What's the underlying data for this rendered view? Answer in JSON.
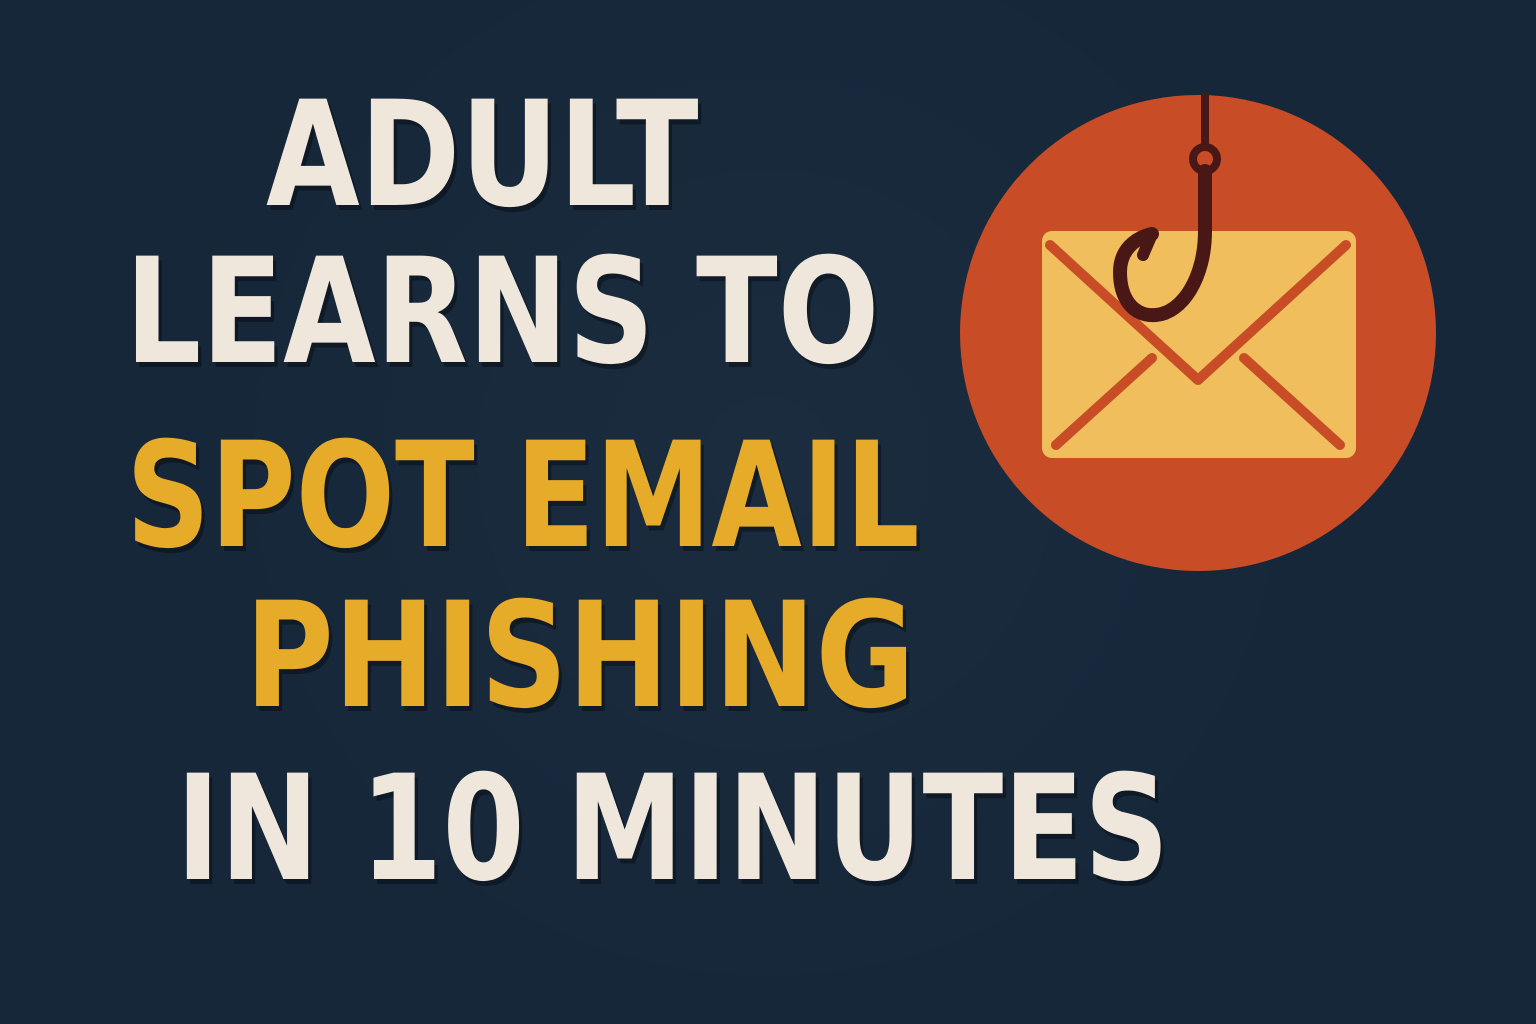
{
  "headline": {
    "line1": "ADULT",
    "line2": "LEARNS TO",
    "line3": "SPOT EMAIL",
    "line4": "PHISHING",
    "line5": "IN 10 MINUTES"
  },
  "icon": {
    "name": "phishing-email-hook-icon",
    "circle_color": "#c84d27",
    "envelope_color": "#f0be5c",
    "hook_color": "#4a1717"
  },
  "colors": {
    "background": "#16273a",
    "text_light": "#efe7dc",
    "text_accent": "#e6ab28"
  }
}
